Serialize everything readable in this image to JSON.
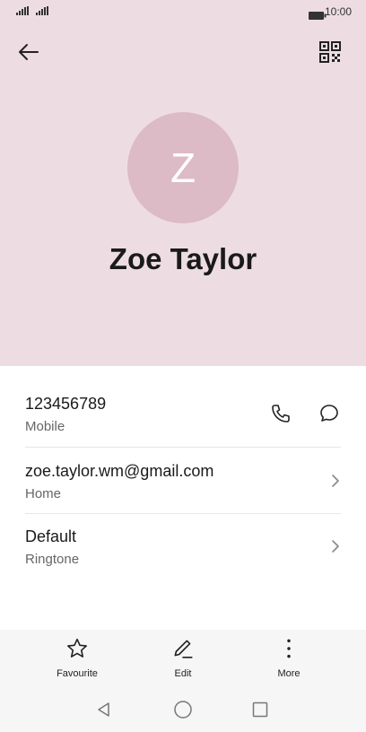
{
  "status_bar": {
    "time": "10:00",
    "signal_icon": "signal-icon",
    "battery_icon": "battery-icon"
  },
  "header": {
    "back_icon": "back-arrow-icon",
    "qr_icon": "qr-code-icon",
    "avatar_letter": "Z",
    "name": "Zoe Taylor",
    "background": "#eddde3",
    "avatar_color": "#dcbac6"
  },
  "details": {
    "phone": {
      "number": "123456789",
      "type": "Mobile",
      "call_icon": "phone-icon",
      "message_icon": "message-icon"
    },
    "email": {
      "address": "zoe.taylor.wm@gmail.com",
      "type": "Home"
    },
    "ringtone": {
      "value": "Default",
      "label": "Ringtone"
    }
  },
  "toolbar": {
    "favourite_label": "Favourite",
    "edit_label": "Edit",
    "more_label": "More"
  },
  "nav": {
    "back": "nav-back-icon",
    "home": "nav-home-icon",
    "recents": "nav-recents-icon"
  }
}
